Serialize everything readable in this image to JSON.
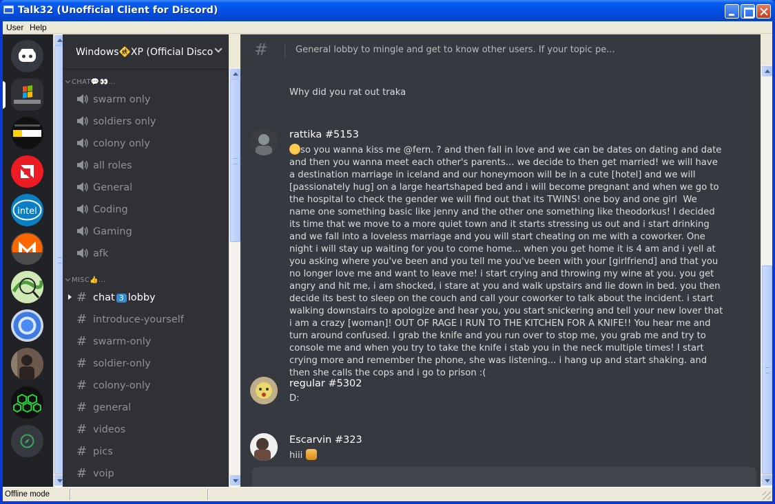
{
  "window": {
    "title": "Talk32 (Unofficial Client for Discord)"
  },
  "menu": {
    "user": "User",
    "help": "Help"
  },
  "guilds": [
    {
      "name": "Discord home",
      "color": "#36393f"
    },
    {
      "name": "Windows XP",
      "color": "#2f3136"
    },
    {
      "name": "PCMR",
      "color": "#111111"
    },
    {
      "name": "AMD",
      "color": "#ed1c24"
    },
    {
      "name": "Intel",
      "color": "#0a7fc4"
    },
    {
      "name": "Monero",
      "color": "#ff6600"
    },
    {
      "name": "Map",
      "color": "#8fcf6a"
    },
    {
      "name": "Chrome",
      "color": "#4a8af4"
    },
    {
      "name": "Photo",
      "color": "#5a4a40"
    },
    {
      "name": "Hex",
      "color": "#111111"
    },
    {
      "name": "Explore",
      "color": "#36393f"
    }
  ],
  "server": {
    "name": "Windows🚸XP (Official Disco"
  },
  "categories": {
    "chat": "CHAT💬👀...",
    "misc": "MISC👍..."
  },
  "voice_channels": [
    "swarm only",
    "soldiers only",
    "colony only",
    "all roles",
    "General",
    "Coding",
    "Gaming",
    "afk"
  ],
  "text_channels": {
    "active_before": "chat",
    "active_badge": "3",
    "active_after": "lobby",
    "others": [
      "introduce-yourself",
      "swarm-only",
      "soldier-only",
      "colony-only",
      "general",
      "videos",
      "pics",
      "voip"
    ]
  },
  "topic": {
    "hash": "#",
    "text": "General lobby to mingle and get to know other users. If your topic pe..."
  },
  "messages": {
    "prev_line": "Why did you rat out traka",
    "rattika": {
      "author": "rattika #5153",
      "text": "so you wanna kiss me @fern. ? ⁠and then fall in love and we can be dates on dating and date and then you wanna meet each other's parents... we decide to then get married! we will have a destination marriage in iceland and our honeymoon will be in a cute [hotel] and we will [passionately hug] on a large heartshaped bed and i will become pregnant and when we go to the hospital to check the gender we will find out that its TWINS! one boy and one girl ⁠ We name one something basic like jenny and the other one something like theodorkus! I decided its time that we move to a more quiet town and it starts stressing us out and i start drinking and we fall into a loveless marriage and you will start cheating on me with a coworker. One night i will stay up waiting for you to come home... when you get home it is 4 am and i yell at you asking where you've been and you tell me you've been with your [girlfriend] and that you no longer love me and want to leave me! i start crying and throwing my wine at you. you get angry and hit me, i am shocked, i stare at you and walk upstairs and lie down in bed. you then decide its best to sleep on the couch and call your coworker to talk about the incident. i start walking downstairs to apologize and hear you, you start snickering and tell your new lover that i am a crazy [woman]! OUT OF RAGE I RUN TO THE KITCHEN FOR A KNIFE!! You hear me and turn around confused. I grab the knife and you run over to stop me, you grab me and try to console me and when you try to take the knife i stab you in the neck multiple times! I start crying more and remember the phone, she was listening... i hang up and start shaking. and then she calls the cops and i go to prison :("
    },
    "regular": {
      "author": "regular #5302",
      "text": "D:"
    },
    "escarvin": {
      "author": "Escarvin #323",
      "text": "hiii"
    }
  },
  "status": {
    "text": "Offline mode"
  },
  "icons": {
    "discord": "discord-logo-icon",
    "speaker": "speaker-icon",
    "hash": "hash-icon",
    "chevron": "chevron-down-icon"
  },
  "colors": {
    "title_blue": "#0453e6",
    "discord_bg": "#36393f",
    "sidebar_bg": "#2f3136",
    "guild_bg": "#202225",
    "mention": "#2f8fd6"
  }
}
